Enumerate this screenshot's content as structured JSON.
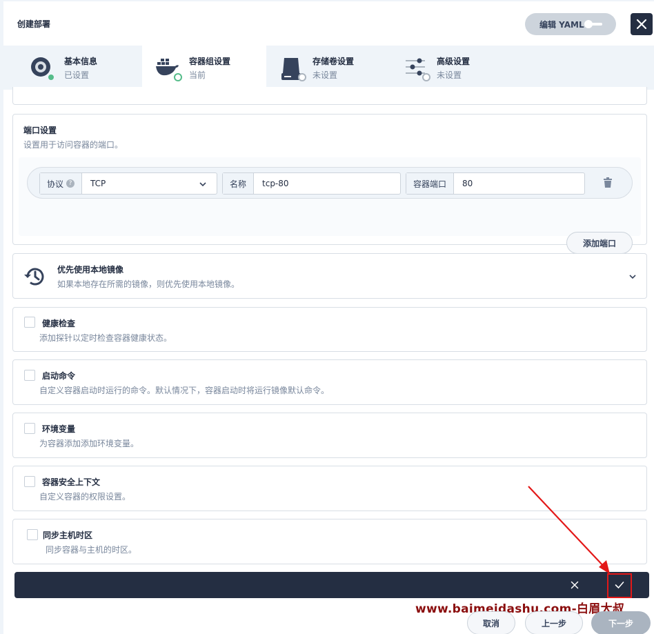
{
  "dialog": {
    "title": "创建部署",
    "yaml_label": "编辑 YAML"
  },
  "steps": [
    {
      "name": "基本信息",
      "status": "已设置",
      "icon": "settings-disc-icon"
    },
    {
      "name": "容器组设置",
      "status": "当前",
      "icon": "docker-whale-icon"
    },
    {
      "name": "存储卷设置",
      "status": "未设置",
      "icon": "hard-drive-icon"
    },
    {
      "name": "高级设置",
      "status": "未设置",
      "icon": "sliders-icon"
    }
  ],
  "ports": {
    "title": "端口设置",
    "desc": "设置用于访问容器的端口。",
    "protocol_label": "协议",
    "protocol_value": "TCP",
    "name_label": "名称",
    "name_value": "tcp-80",
    "container_port_label": "容器端口",
    "container_port_value": "80",
    "add_label": "添加端口"
  },
  "local_image": {
    "title": "优先使用本地镜像",
    "desc": "如果本地存在所需的镜像，则优先使用本地镜像。"
  },
  "options": [
    {
      "title": "健康检查",
      "desc": "添加探针以定时检查容器健康状态。"
    },
    {
      "title": "启动命令",
      "desc": "自定义容器启动时运行的命令。默认情况下，容器启动时将运行镜像默认命令。"
    },
    {
      "title": "环境变量",
      "desc": "为容器添加添加环境变量。"
    },
    {
      "title": "容器安全上下文",
      "desc": "自定义容器的权限设置。"
    },
    {
      "title": "同步主机时区",
      "desc": "同步容器与主机的时区。"
    }
  ],
  "watermark": "www.baimeidashu.com-白眉大叔",
  "footer": {
    "cancel": "取消",
    "prev": "上一步",
    "next": "下一步"
  },
  "colors": {
    "dark": "#242e42",
    "success": "#55bc8a",
    "annotation_red": "#e31818"
  }
}
